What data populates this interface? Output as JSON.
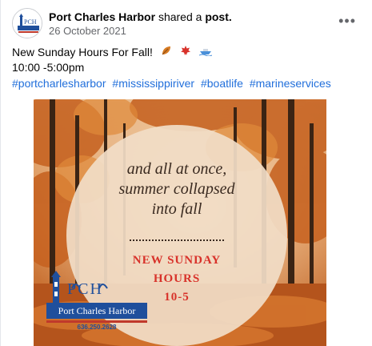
{
  "post": {
    "page_name": "Port Charles Harbor",
    "action": "shared a",
    "post_link": "post.",
    "date": "26 October 2021",
    "more_label": "•••",
    "text_line1": "New Sunday Hours For Fall!",
    "text_line2": "10:00 -5:00pm",
    "hashtags": [
      "#portcharlesharbor",
      "#mississippiriver",
      "#boatlife",
      "#marineservices"
    ]
  },
  "image": {
    "quote_line1": "and all at once,",
    "quote_line2": "summer collapsed",
    "quote_line3": "into fall",
    "hours_line1": "NEW SUNDAY",
    "hours_line2": "HOURS",
    "hours_line3": "10-5",
    "logo_text": "Port Charles Harbor",
    "logo_phone": "636.250.2628",
    "logo_initials": "PCH"
  },
  "colors": {
    "link": "#216fdb",
    "accent_red": "#d8322a",
    "circle": "#f1ddc6"
  }
}
